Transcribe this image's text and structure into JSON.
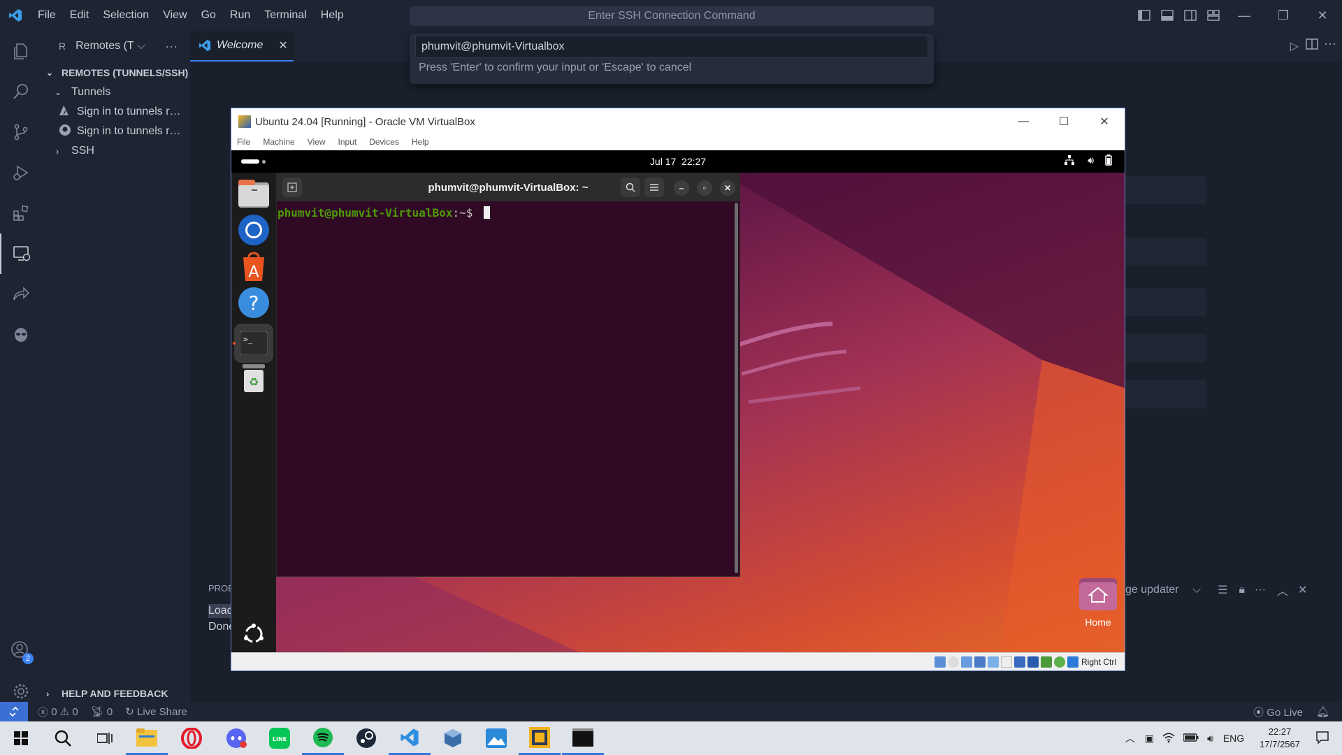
{
  "titlebar": {
    "menu": [
      "File",
      "Edit",
      "Selection",
      "View",
      "Go",
      "Run",
      "Terminal",
      "Help"
    ],
    "command_center_placeholder": "Enter SSH Connection Command"
  },
  "quick_input": {
    "value": "phumvit@phumvit-Virtualbox",
    "hint": "Press 'Enter' to confirm your input or 'Escape' to cancel"
  },
  "sidebar": {
    "view_prefix": "R",
    "view_title": "Remotes (Tunnels/SSH)",
    "section_title": "REMOTES (TUNNELS/SSH)",
    "tunnels_label": "Tunnels",
    "tunnel_items": [
      "Sign in to tunnels registered with Microsoft",
      "Sign in to tunnels registered with GitHub"
    ],
    "ssh_label": "SSH",
    "help_label": "HELP AND FEEDBACK"
  },
  "tabs": [
    {
      "label": "Welcome"
    }
  ],
  "activity_badge": "2",
  "panel": {
    "tab_fragment": "PROB",
    "line1_fragment": "Load",
    "line2_fragment": "Done",
    "dropdown_fragment": "ge updater"
  },
  "statusbar": {
    "errors": "0",
    "warnings": "0",
    "ports": "0",
    "live_share": "Live Share",
    "go_live": "Go Live"
  },
  "vbox": {
    "title": "Ubuntu 24.04 [Running] - Oracle VM VirtualBox",
    "menu": [
      "File",
      "Machine",
      "View",
      "Input",
      "Devices",
      "Help"
    ],
    "host_key": "Right Ctrl"
  },
  "ubuntu": {
    "date": "Jul 17",
    "time": "22:27",
    "terminal_title": "phumvit@phumvit-VirtualBox: ~",
    "prompt_user": "phumvit@phumvit-VirtualBox",
    "prompt_path": ":~$",
    "home_label": "Home"
  },
  "taskbar": {
    "lang": "ENG",
    "time": "22:27",
    "date": "17/7/2567"
  },
  "colors": {
    "accent": "#3b82f6",
    "remote_button": "#3b6fd4",
    "terminal_bg": "#300a24",
    "prompt_green": "#4e9a06"
  }
}
